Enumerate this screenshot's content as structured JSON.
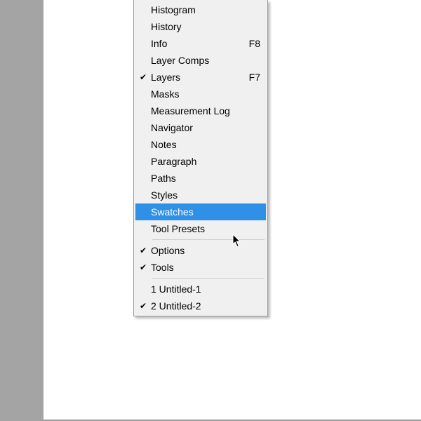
{
  "menu": {
    "highlight_bg": "#2f90e7",
    "groups": [
      {
        "items": [
          {
            "label": "Histogram",
            "shortcut": "",
            "checked": false,
            "highlight": false
          },
          {
            "label": "History",
            "shortcut": "",
            "checked": false,
            "highlight": false
          },
          {
            "label": "Info",
            "shortcut": "F8",
            "checked": false,
            "highlight": false
          },
          {
            "label": "Layer Comps",
            "shortcut": "",
            "checked": false,
            "highlight": false
          },
          {
            "label": "Layers",
            "shortcut": "F7",
            "checked": true,
            "highlight": false
          },
          {
            "label": "Masks",
            "shortcut": "",
            "checked": false,
            "highlight": false
          },
          {
            "label": "Measurement Log",
            "shortcut": "",
            "checked": false,
            "highlight": false
          },
          {
            "label": "Navigator",
            "shortcut": "",
            "checked": false,
            "highlight": false
          },
          {
            "label": "Notes",
            "shortcut": "",
            "checked": false,
            "highlight": false
          },
          {
            "label": "Paragraph",
            "shortcut": "",
            "checked": false,
            "highlight": false
          },
          {
            "label": "Paths",
            "shortcut": "",
            "checked": false,
            "highlight": false
          },
          {
            "label": "Styles",
            "shortcut": "",
            "checked": false,
            "highlight": false
          },
          {
            "label": "Swatches",
            "shortcut": "",
            "checked": false,
            "highlight": true
          },
          {
            "label": "Tool Presets",
            "shortcut": "",
            "checked": false,
            "highlight": false
          }
        ]
      },
      {
        "items": [
          {
            "label": "Options",
            "shortcut": "",
            "checked": true,
            "highlight": false
          },
          {
            "label": "Tools",
            "shortcut": "",
            "checked": true,
            "highlight": false
          }
        ]
      },
      {
        "items": [
          {
            "label": "1 Untitled-1",
            "shortcut": "",
            "checked": false,
            "highlight": false
          },
          {
            "label": "2 Untitled-2",
            "shortcut": "",
            "checked": true,
            "highlight": false
          }
        ]
      }
    ]
  }
}
